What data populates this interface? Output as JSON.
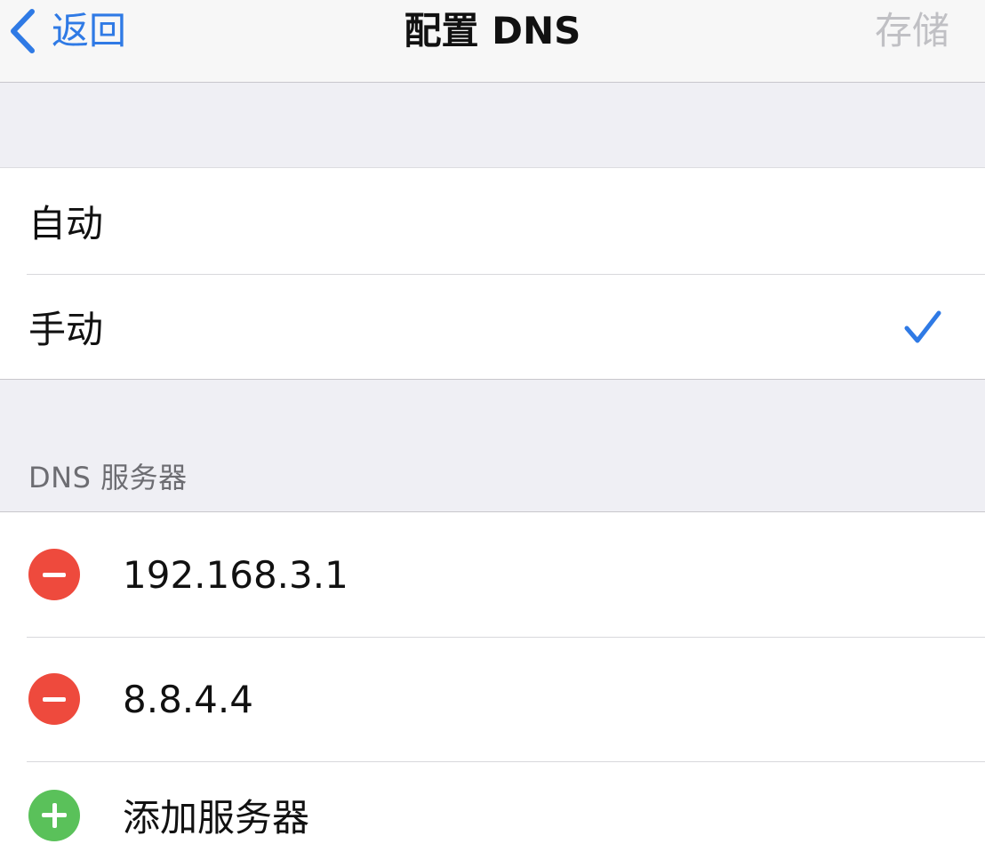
{
  "navbar": {
    "back_label": "返回",
    "title": "配置 DNS",
    "save_label": "存储"
  },
  "mode": {
    "options": [
      {
        "label": "自动",
        "selected": false
      },
      {
        "label": "手动",
        "selected": true
      }
    ]
  },
  "dns": {
    "header": "DNS 服务器",
    "servers": [
      "192.168.3.1",
      "8.8.4.4"
    ],
    "add_label": "添加服务器"
  },
  "colors": {
    "accent": "#2f7ae5",
    "delete": "#ee4a3d",
    "add": "#5ac15a",
    "disabled": "#c0c0c4"
  }
}
